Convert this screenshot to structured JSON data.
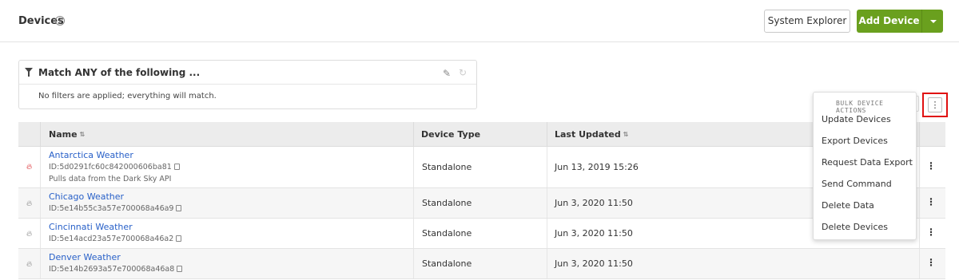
{
  "header": {
    "title": "Devices",
    "help_icon": "question-circle-icon",
    "system_explorer_label": "System Explorer",
    "add_device_label": "Add Device",
    "accent_color": "#6aa01e"
  },
  "filter": {
    "title": "Match ANY of the following ...",
    "message": "No filters are applied; everything will match."
  },
  "table": {
    "columns": [
      "Name",
      "Device Type",
      "Last Updated"
    ],
    "rows": [
      {
        "name": "Antarctica Weather",
        "id": "ID:5d0291fc60c842000606ba81",
        "description": "Pulls data from the Dark Sky API",
        "type": "Standalone",
        "updated": "Jun 13, 2019 15:26"
      },
      {
        "name": "Chicago Weather",
        "id": "ID:5e14b55c3a57e700068a46a9",
        "description": "",
        "type": "Standalone",
        "updated": "Jun 3, 2020 11:50"
      },
      {
        "name": "Cincinnati Weather",
        "id": "ID:5e14acd23a57e700068a46a2",
        "description": "",
        "type": "Standalone",
        "updated": "Jun 3, 2020 11:50"
      },
      {
        "name": "Denver Weather",
        "id": "ID:5e14b2693a57e700068a46a8",
        "description": "",
        "type": "Standalone",
        "updated": "Jun 3, 2020 11:50"
      }
    ]
  },
  "bulk_menu": {
    "header": "BULK DEVICE ACTIONS",
    "items": [
      "Update Devices",
      "Export Devices",
      "Request Data Export",
      "Send Command",
      "Delete Data",
      "Delete Devices"
    ]
  },
  "icons": {
    "kebab": "⋮",
    "pencil": "✎",
    "refresh": "↻",
    "sort": "⇅"
  }
}
